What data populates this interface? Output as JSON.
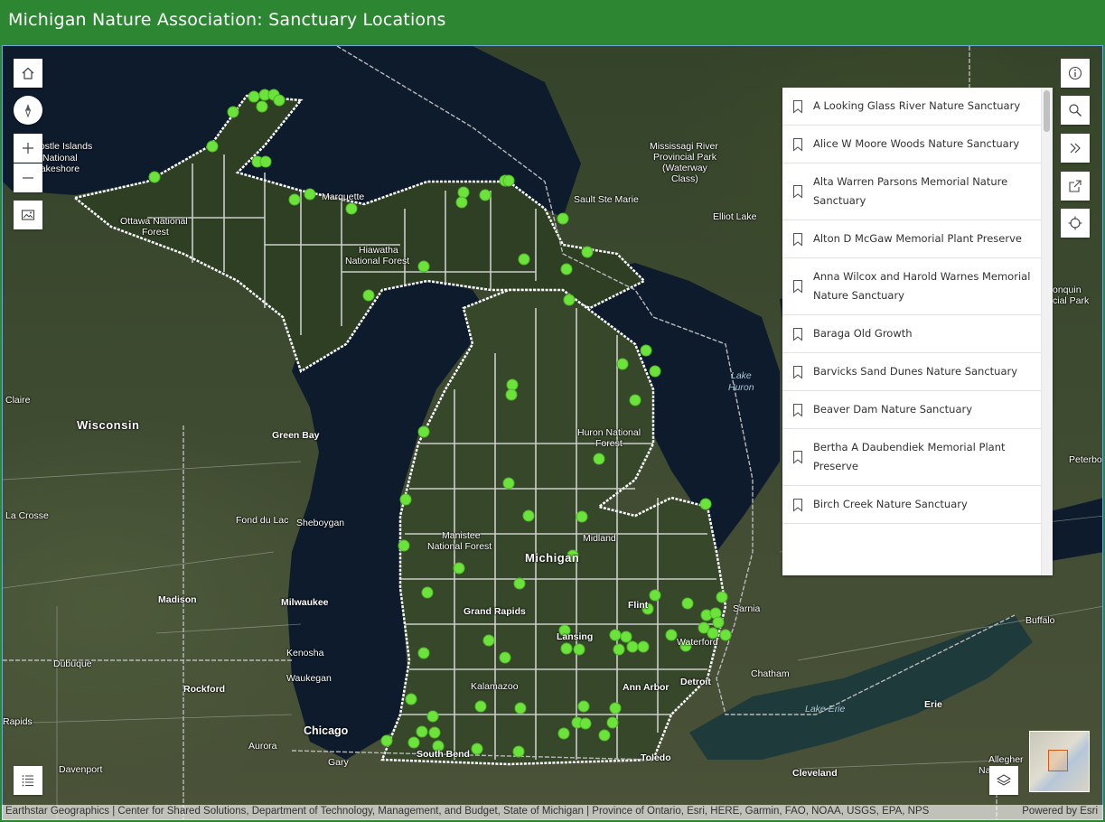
{
  "header": {
    "title": "Michigan Nature Association: Sanctuary Locations"
  },
  "map": {
    "labels": {
      "apostle": "Apostle Islands",
      "national": "National",
      "lakeshore": "Lakeshore",
      "ottawa": "Ottawa National",
      "forest": "Forest",
      "marquette": "Marquette",
      "hiawatha": "Hiawatha",
      "hiawatha2": "National Forest",
      "mississagi1": "Mississagi River",
      "mississagi2": "Provincial Park",
      "mississagi3": "(Waterway",
      "mississagi4": "Class)",
      "saultstemarie": "Sault Ste Marie",
      "elliotlake": "Elliot Lake",
      "algonquin1": "onquin",
      "algonquin2": "cial Park",
      "lakehuron1": "Lake",
      "lakehuron2": "Huron",
      "claire": "Claire",
      "wisconsin": "Wisconsin",
      "greenbay": "Green Bay",
      "huron1": "Huron National",
      "huron2": "Forest",
      "peterborough": "Peterbo",
      "lacrosse": "La Crosse",
      "fonddulac": "Fond du Lac",
      "sheboygan": "Sheboygan",
      "manistee1": "Manistee",
      "manistee2": "National Forest",
      "midland": "Midland",
      "michigan": "Michigan",
      "madison": "Madison",
      "milwaukee": "Milwaukee",
      "grandrapids": "Grand Rapids",
      "flint": "Flint",
      "sarnia": "Sarnia",
      "buffalo": "Buffalo",
      "lansing": "Lansing",
      "waterford": "Waterford",
      "kenosha": "Kenosha",
      "dubuque": "Dubuque",
      "waukegan": "Waukegan",
      "chatham": "Chatham",
      "rockford": "Rockford",
      "kalamazoo": "Kalamazoo",
      "annarbor": "Ann Arbor",
      "detroit": "Detroit",
      "lakeerie": "Lake Erie",
      "erie": "Erie",
      "rapids": "Rapids",
      "chicago": "Chicago",
      "aurora": "Aurora",
      "southbend": "South Bend",
      "toledo": "Toledo",
      "allegheny1": "Allegher",
      "allegheny2": "Na",
      "cleveland": "Cleveland",
      "gary": "Gary",
      "davenport": "Davenport"
    }
  },
  "controls": {
    "home_icon": "home-icon",
    "compass_icon": "compass-icon",
    "zoom_in_icon": "plus-icon",
    "zoom_out_icon": "minus-icon",
    "basemap_icon": "image-icon",
    "legend_icon": "list-icon",
    "info_icon": "info-icon",
    "search_icon": "search-icon",
    "collapse_icon": "chevrons-right-icon",
    "share_icon": "share-icon",
    "locate_icon": "locate-icon",
    "layers_icon": "layers-icon"
  },
  "list": {
    "items": [
      {
        "label": "A Looking Glass River Nature Sanctuary"
      },
      {
        "label": "Alice W Moore Woods Nature Sanctuary"
      },
      {
        "label": "Alta Warren Parsons Memorial Nature Sanctuary"
      },
      {
        "label": "Alton D McGaw Memorial Plant Preserve"
      },
      {
        "label": "Anna Wilcox and Harold Warnes Memorial Nature Sanctuary"
      },
      {
        "label": "Baraga Old Growth"
      },
      {
        "label": "Barvicks Sand Dunes Nature Sanctuary"
      },
      {
        "label": "Beaver Dam Nature Sanctuary"
      },
      {
        "label": "Bertha A Daubendiek Memorial Plant Preserve"
      },
      {
        "label": "Birch Creek Nature Sanctuary"
      }
    ]
  },
  "attribution": {
    "text": "Earthstar Geographics | Center for Shared Solutions, Department of Technology, Management, and Budget, State of Michigan | Province of Ontario, Esri, HERE, Garmin, FAO, NOAA, USGS, EPA, NPS",
    "powered": "Powered by Esri"
  },
  "colors": {
    "header": "#2d8632",
    "point": "#6be33a",
    "water": "#0e1b2c",
    "land": "#3e4b31"
  }
}
